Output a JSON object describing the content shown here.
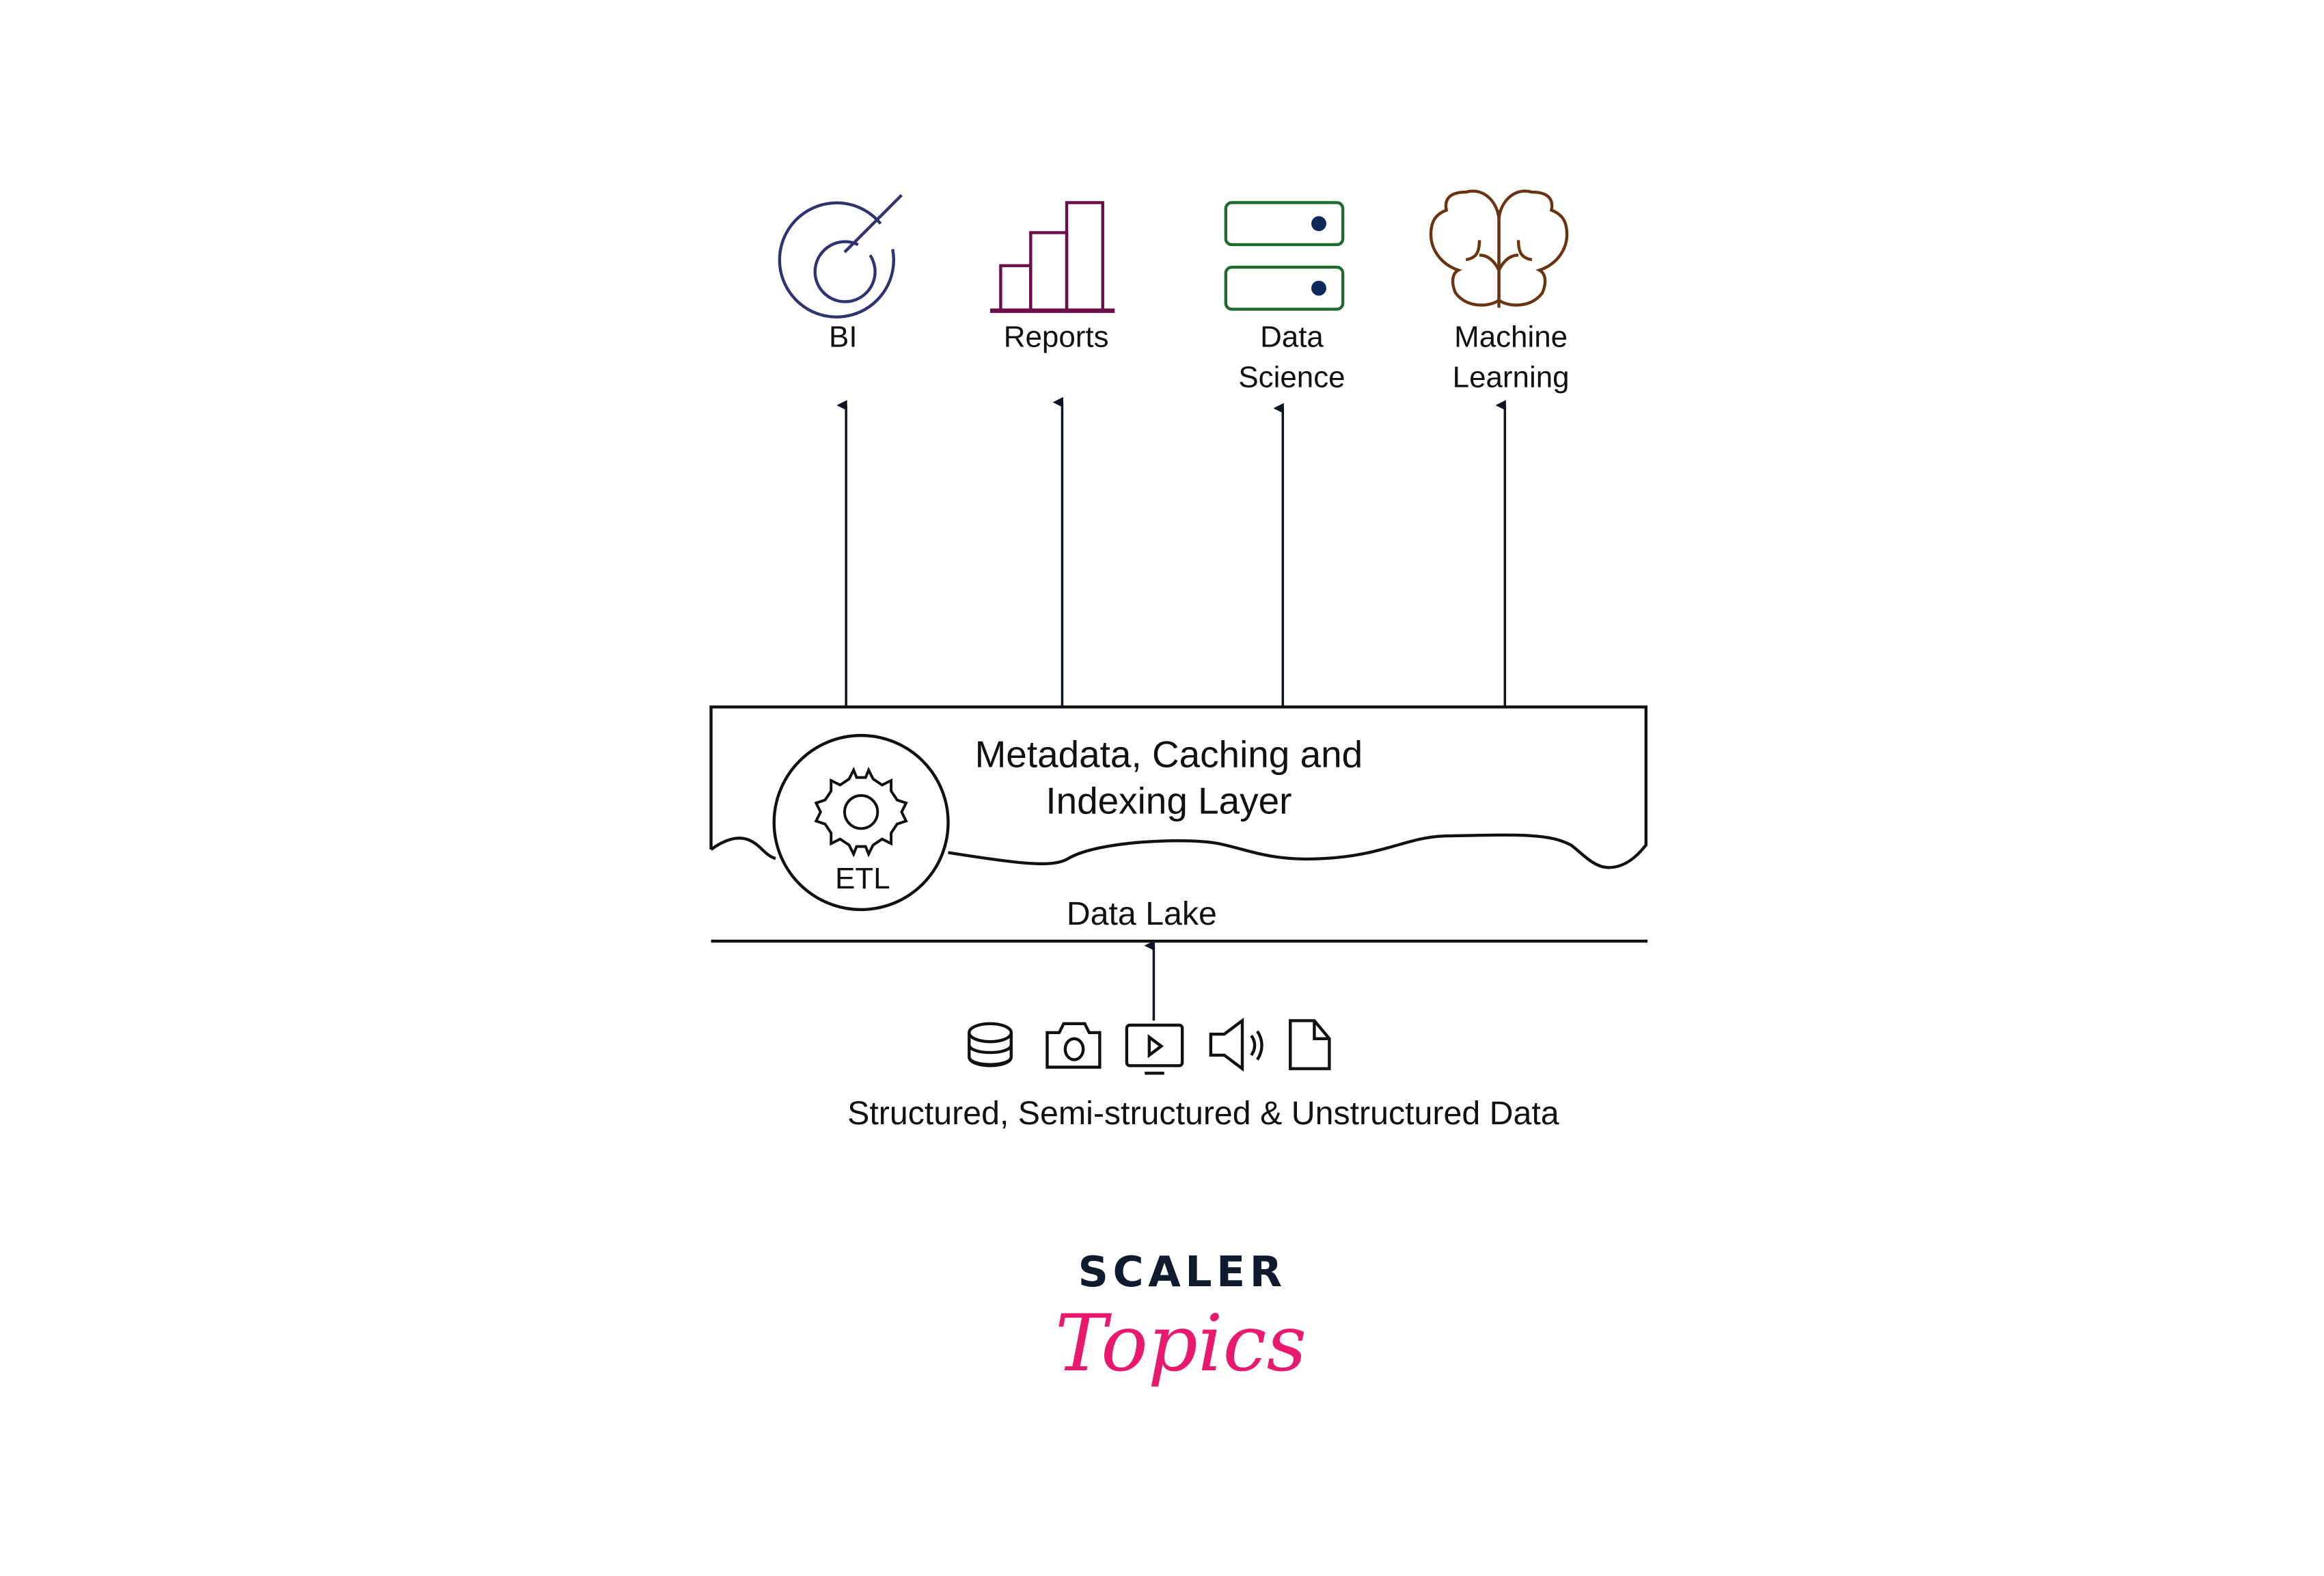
{
  "consumers": [
    {
      "label_lines": [
        "BI"
      ],
      "icon": "target-icon",
      "color": "#2e3470"
    },
    {
      "label_lines": [
        "Reports"
      ],
      "icon": "bar-chart-icon",
      "color": "#6b0f4a"
    },
    {
      "label_lines": [
        "Data",
        "Science"
      ],
      "icon": "server-icon",
      "color": "#1f6b2e"
    },
    {
      "label_lines": [
        "Machine",
        "Learning"
      ],
      "icon": "brain-icon",
      "color": "#6b3410"
    }
  ],
  "layer": {
    "title_line1": "Metadata, Caching and",
    "title_line2": "Indexing Layer",
    "etl_label": "ETL",
    "lake_label": "Data Lake"
  },
  "sources": {
    "icons": [
      "database-icon",
      "camera-icon",
      "video-icon",
      "speaker-icon",
      "file-icon"
    ],
    "caption": "Structured, Semi-structured & Unstructured Data"
  },
  "logo": {
    "top": "SCALER",
    "bottom": "Topics",
    "top_color": "#0e1a2e",
    "bottom_color": "#e8196f"
  }
}
